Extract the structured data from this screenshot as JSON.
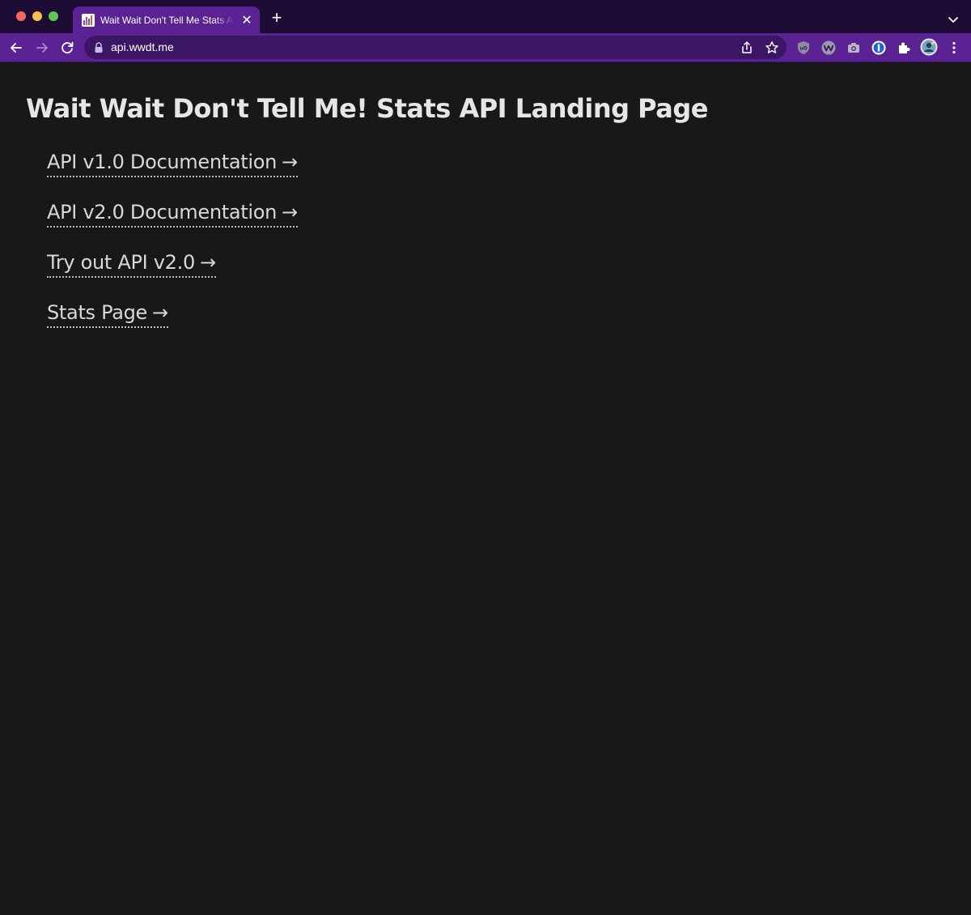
{
  "browser": {
    "tab": {
      "title": "Wait Wait Don't Tell Me Stats API Landing Page",
      "close_glyph": "✕"
    },
    "new_tab_glyph": "+",
    "address_bar": {
      "url": "api.wwdt.me"
    },
    "colors": {
      "frame": "#1d0c34",
      "toolbar": "#5b2294",
      "omnibox": "#3a1665"
    }
  },
  "page": {
    "title": "Wait Wait Don't Tell Me! Stats API Landing Page",
    "links": [
      {
        "label": "API v1.0 Documentation",
        "arrow": "→"
      },
      {
        "label": "API v2.0 Documentation",
        "arrow": "→"
      },
      {
        "label": "Try out API v2.0",
        "arrow": "→"
      },
      {
        "label": "Stats Page",
        "arrow": "→"
      }
    ],
    "colors": {
      "background": "#181818",
      "text": "#dcdcdc"
    }
  },
  "icons": {
    "back": "arrow-left-icon",
    "forward": "arrow-right-icon",
    "reload": "reload-icon",
    "lock": "lock-icon",
    "share": "share-icon",
    "bookmark": "star-icon",
    "extensions": [
      "ublock-icon",
      "wappalyzer-icon",
      "camera-icon",
      "password-manager-icon",
      "puzzle-icon"
    ],
    "profile": "avatar",
    "menu": "kebab-menu-icon",
    "tab_search": "chevron-down-icon"
  }
}
